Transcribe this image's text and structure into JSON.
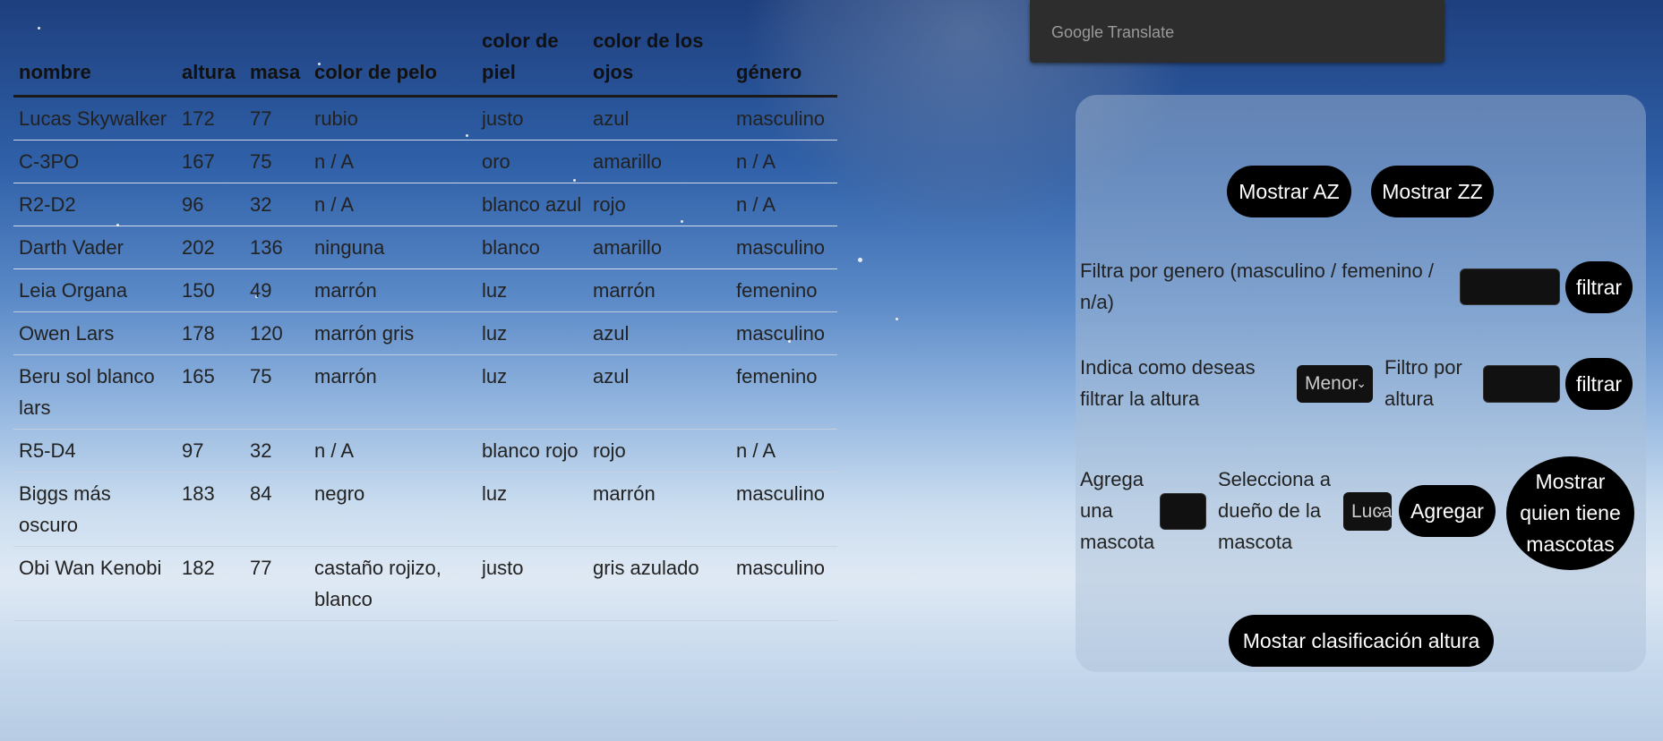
{
  "table": {
    "headers": [
      "nombre",
      "altura",
      "masa",
      "color de pelo",
      "color de piel",
      "color de los ojos",
      "género"
    ],
    "rows": [
      [
        "Lucas Skywalker",
        "172",
        "77",
        "rubio",
        "justo",
        "azul",
        "masculino"
      ],
      [
        "C-3PO",
        "167",
        "75",
        "n / A",
        "oro",
        "amarillo",
        "n / A"
      ],
      [
        "R2-D2",
        "96",
        "32",
        "n / A",
        "blanco azul",
        "rojo",
        "n / A"
      ],
      [
        "Darth Vader",
        "202",
        "136",
        "ninguna",
        "blanco",
        "amarillo",
        "masculino"
      ],
      [
        "Leia Organa",
        "150",
        "49",
        "marrón",
        "luz",
        "marrón",
        "femenino"
      ],
      [
        "Owen Lars",
        "178",
        "120",
        "marrón gris",
        "luz",
        "azul",
        "masculino"
      ],
      [
        "Beru sol blanco lars",
        "165",
        "75",
        "marrón",
        "luz",
        "azul",
        "femenino"
      ],
      [
        "R5-D4",
        "97",
        "32",
        "n / A",
        "blanco rojo",
        "rojo",
        "n / A"
      ],
      [
        "Biggs más oscuro",
        "183",
        "84",
        "negro",
        "luz",
        "marrón",
        "masculino"
      ],
      [
        "Obi Wan Kenobi",
        "182",
        "77",
        "castaño rojizo, blanco",
        "justo",
        "gris azulado",
        "masculino"
      ]
    ]
  },
  "translate": {
    "label": "Google Translate"
  },
  "panel": {
    "sort_az_label": "Mostrar AZ",
    "sort_zz_label": "Mostrar ZZ",
    "gender_filter_label": "Filtra por genero (masculino / femenino / n/a)",
    "gender_filter_value": "",
    "filter_button_label": "filtrar",
    "height_mode_label": "Indica como deseas filtrar la altura",
    "height_mode_selected": "Menor",
    "height_filter_label": "Filtro por altura",
    "height_filter_value": "",
    "height_filter_button_label": "filtrar",
    "pet_label": "Agrega una mascota",
    "pet_value": "",
    "owner_label": "Selecciona a dueño de la mascota",
    "owner_selected": "Lucas Skywalker",
    "add_button_label": "Agregar",
    "show_pets_label": "Mostrar quien tiene mascotas",
    "height_rank_label": "Mostar clasificación altura"
  }
}
